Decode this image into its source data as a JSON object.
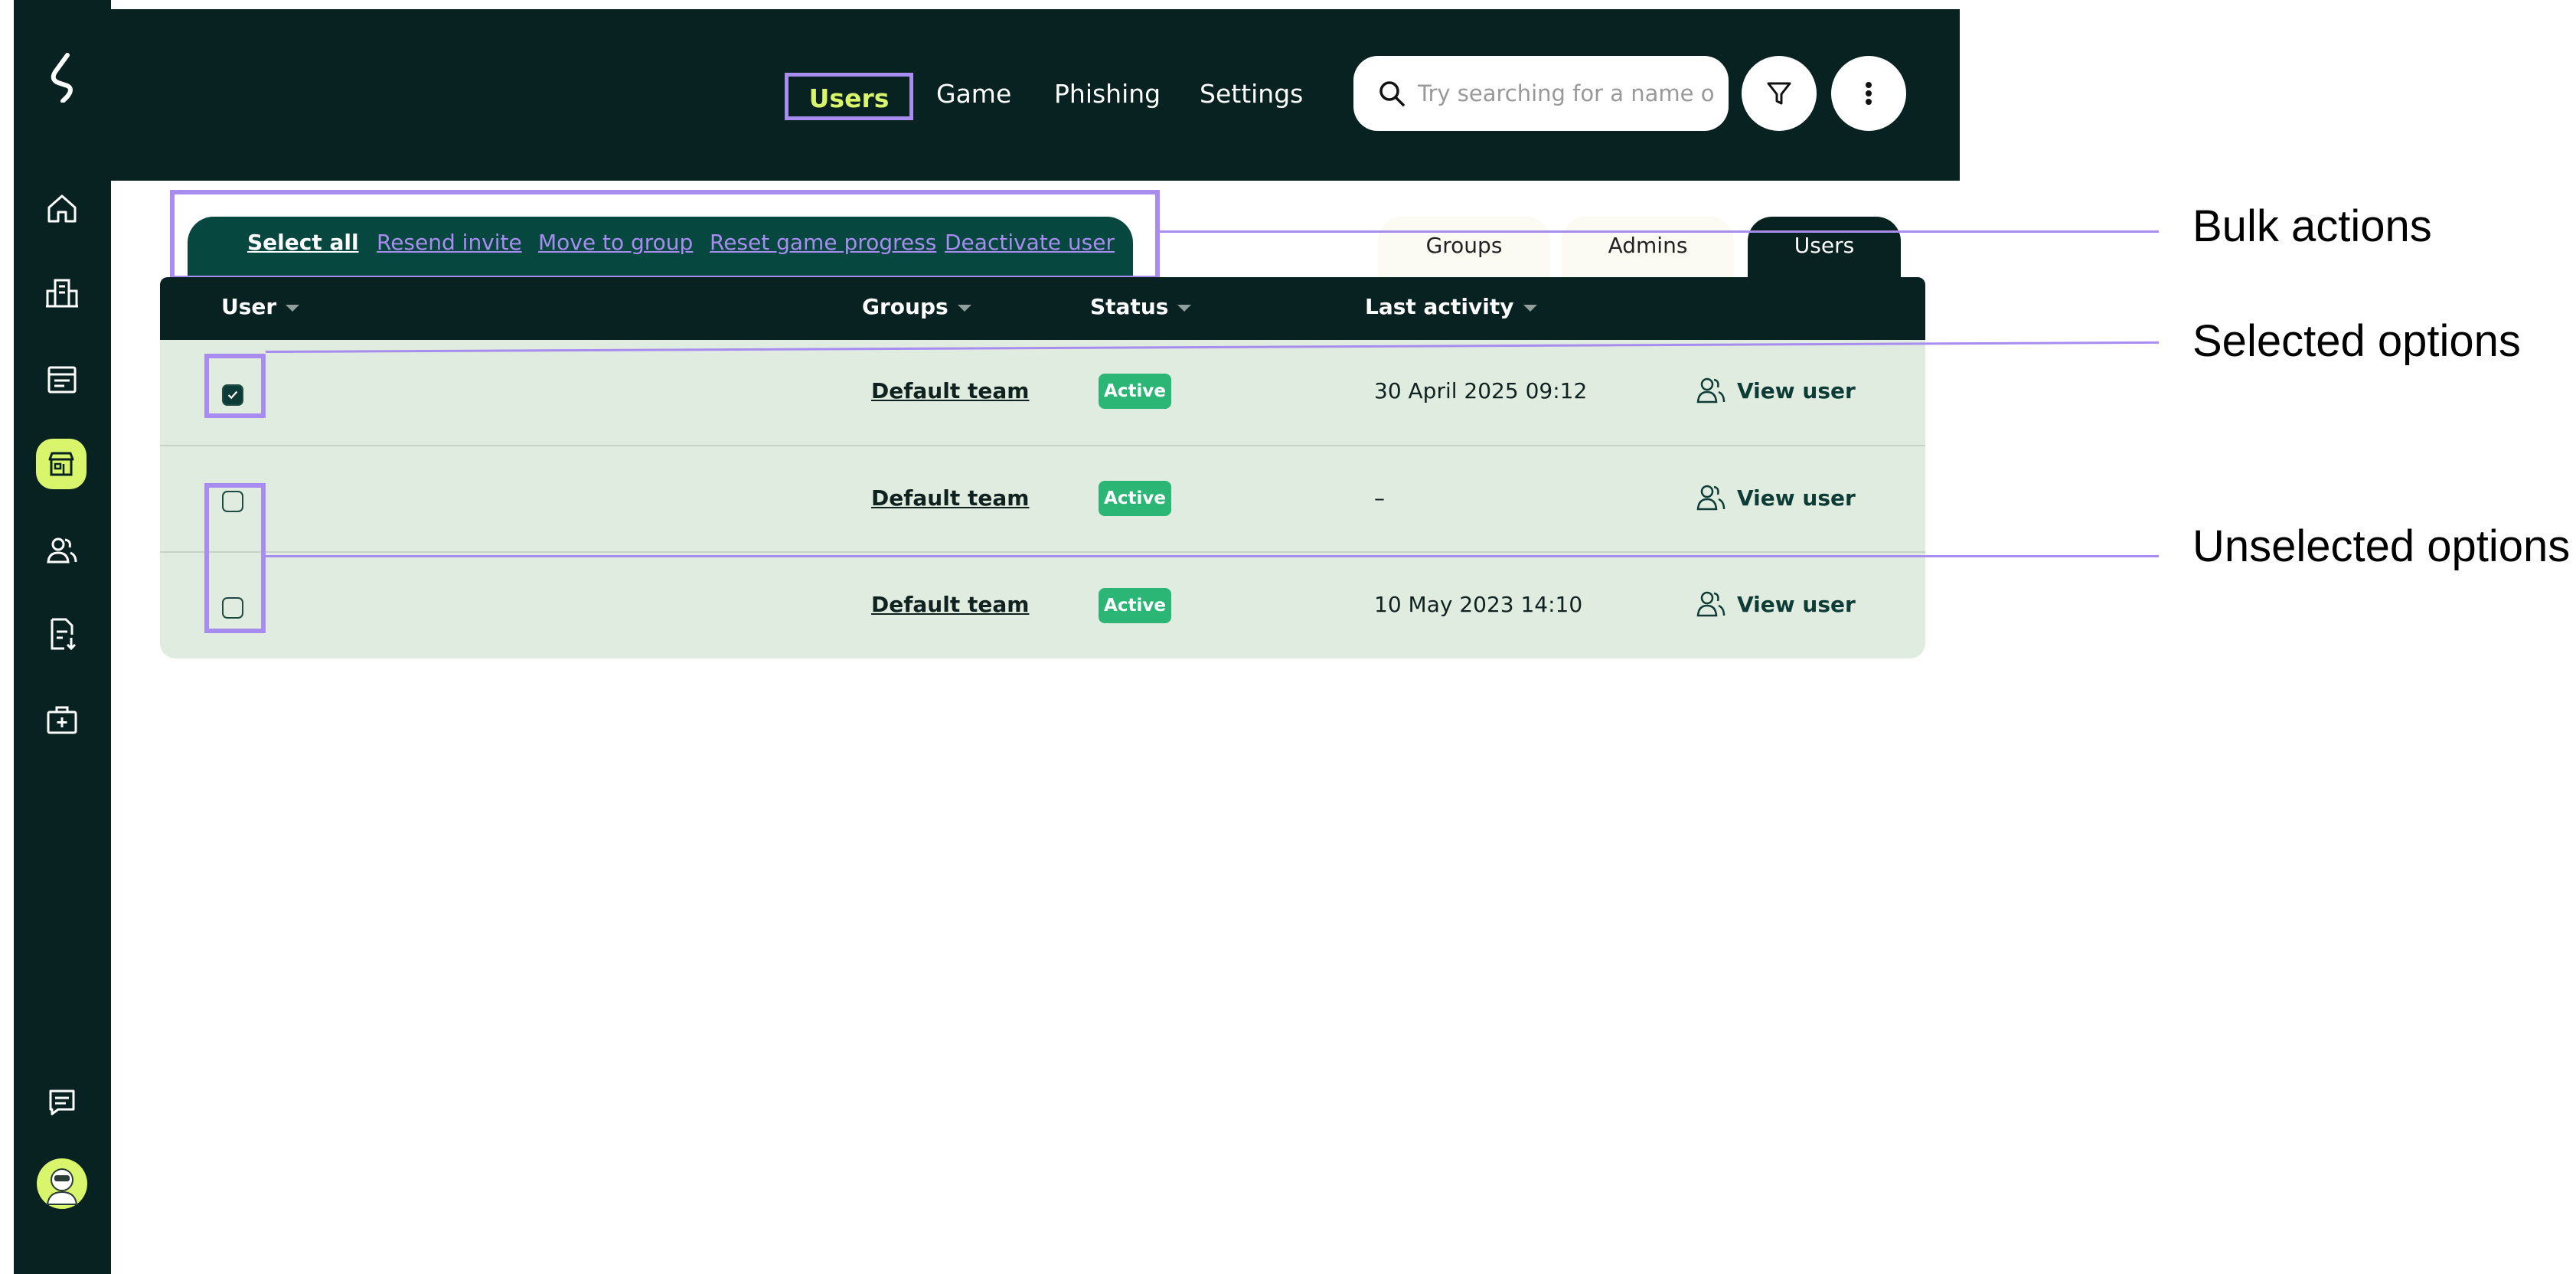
{
  "nav": {
    "items": [
      "Users",
      "Game",
      "Phishing",
      "Settings"
    ]
  },
  "search": {
    "placeholder": "Try searching for a name or e"
  },
  "bulk_actions": {
    "select_all": "Select all",
    "items": [
      "Resend invite",
      "Move to group",
      "Reset game progress",
      "Deactivate user"
    ]
  },
  "view_tabs": [
    "Groups",
    "Admins",
    "Users"
  ],
  "table": {
    "columns": [
      "User",
      "Groups",
      "Status",
      "Last activity"
    ],
    "rows": [
      {
        "checked": true,
        "group": "Default team",
        "status": "Active",
        "last_activity": "30 April 2025 09:12",
        "action": "View user"
      },
      {
        "checked": false,
        "group": "Default team",
        "status": "Active",
        "last_activity": "–",
        "action": "View user"
      },
      {
        "checked": false,
        "group": "Default team",
        "status": "Active",
        "last_activity": "10 May 2023 14:10",
        "action": "View user"
      }
    ]
  },
  "annotations": {
    "bulk_actions": "Bulk actions",
    "selected_options": "Selected options",
    "unselected_options": "Unselected options"
  },
  "colors": {
    "sidebar_bg": "#072220",
    "accent": "#d9f56b",
    "highlight": "#a88cf0",
    "status_active": "#2bb676",
    "row_bg": "#e1ece0"
  }
}
